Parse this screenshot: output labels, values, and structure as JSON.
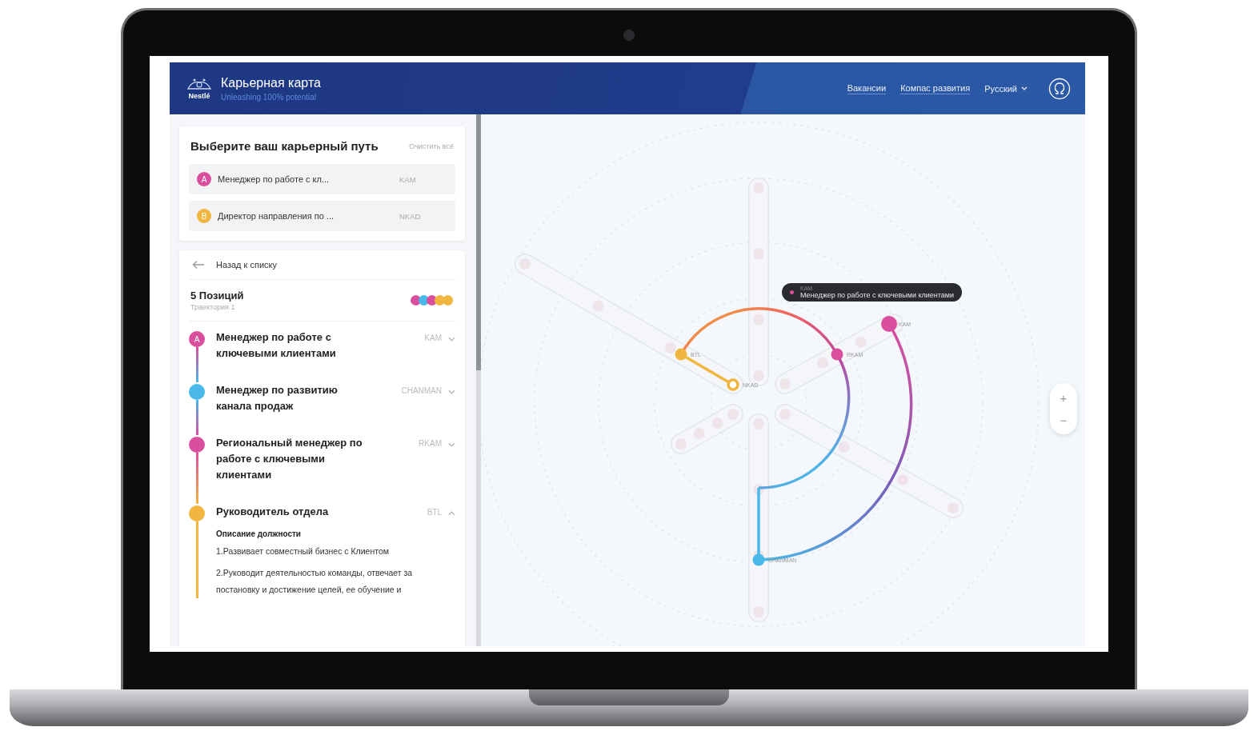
{
  "header": {
    "logo_text": "Nestlé",
    "title": "Карьерная карта",
    "subtitle": "Unleashing 100% potential",
    "nav": [
      {
        "label": "Вакансии",
        "kind": "link"
      },
      {
        "label": "Компас развития",
        "kind": "link"
      },
      {
        "label": "Русский",
        "kind": "dropdown"
      }
    ]
  },
  "path_picker": {
    "title": "Выберите ваш карьерный путь",
    "clear": "Очистить всё",
    "choices": [
      {
        "letter": "A",
        "color": "#d94f9e",
        "name": "Менеджер по работе с кл...",
        "code": "KAM"
      },
      {
        "letter": "B",
        "color": "#f0b640",
        "name": "Директор направления по ...",
        "code": "NKAD"
      }
    ]
  },
  "trajectory": {
    "back": "Назад к списку",
    "count": "5 Позиций",
    "subtitle": "Траектория 1",
    "dots": [
      {
        "color": "#d94f9e"
      },
      {
        "color": "#4ab8e8"
      },
      {
        "color": "#d94f9e"
      },
      {
        "color": "#f0b640"
      },
      {
        "color": "#f0b640"
      }
    ],
    "positions": [
      {
        "letter": "A",
        "color": "#d94f9e",
        "title": "Менеджер по работе с ключевыми клиентами",
        "code": "KAM",
        "expanded": false
      },
      {
        "color": "#4ab8e8",
        "title": "Менеджер по развитию канала продаж",
        "code": "CHANMAN",
        "expanded": false
      },
      {
        "color": "#d94f9e",
        "title": "Региональный менеджер по работе с ключевыми клиентами",
        "code": "RKAM",
        "expanded": false
      },
      {
        "color": "#f0b640",
        "title": "Руководитель отдела",
        "code": "BTL",
        "expanded": true,
        "description_title": "Описание должности",
        "description": [
          "1.Развивает совместный бизнес с Клиентом",
          "2.Руководит деятельностью команды, отвечает за постановку и достижение целей, ее обучение и"
        ]
      }
    ]
  },
  "map": {
    "nodes": [
      {
        "label": "KAM",
        "color": "#d94f9e",
        "kind": "large"
      },
      {
        "label": "RKAM",
        "color": "#d94f9e",
        "kind": "dot"
      },
      {
        "label": "BTL",
        "color": "#f0b640",
        "kind": "dot"
      },
      {
        "label": "NKAD",
        "color": "#f0b640",
        "kind": "ring"
      },
      {
        "label": "CHANMAN",
        "color": "#4ab8e8",
        "kind": "dot"
      }
    ],
    "tooltip": {
      "code": "KAM",
      "title": "Менеджер по работе с ключевыми клиентами",
      "color": "#d94f9e"
    },
    "zoom": [
      "+",
      "−"
    ]
  }
}
